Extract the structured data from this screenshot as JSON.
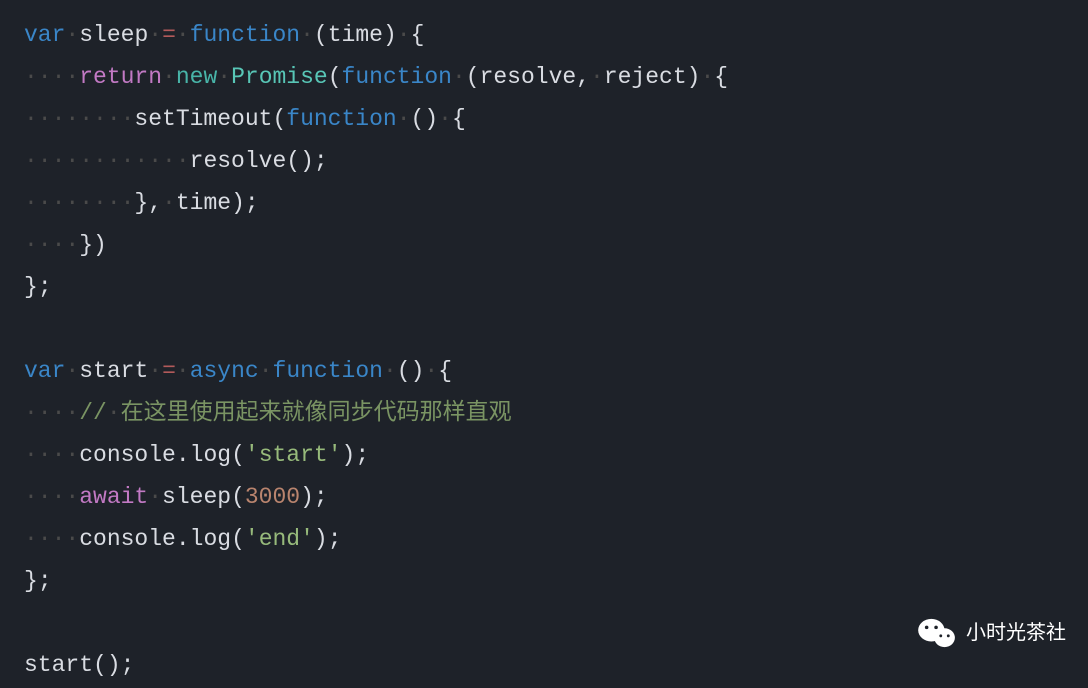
{
  "code": {
    "line1": {
      "var": "var",
      "ws1": "·",
      "name": "sleep",
      "ws2": "·",
      "eq": "=",
      "ws3": "·",
      "func": "function",
      "ws4": "·",
      "lparen": "(",
      "param": "time",
      "rparen": ")",
      "ws5": "·",
      "lbrace": "{"
    },
    "line2": {
      "ws_lead": "····",
      "ret": "return",
      "ws1": "·",
      "new": "new",
      "ws2": "·",
      "cls": "Promise",
      "lparen": "(",
      "func": "function",
      "ws3": "·",
      "lparen2": "(",
      "p1": "resolve",
      "comma": ",",
      "ws4": "·",
      "p2": "reject",
      "rparen2": ")",
      "ws5": "·",
      "lbrace": "{"
    },
    "line3": {
      "ws_lead": "········",
      "fn": "setTimeout",
      "lparen": "(",
      "func": "function",
      "ws1": "·",
      "lparen2": "(",
      "rparen2": ")",
      "ws2": "·",
      "lbrace": "{"
    },
    "line4": {
      "ws_lead": "············",
      "fn": "resolve",
      "lparen": "(",
      "rparen": ")",
      "semi": ";"
    },
    "line5": {
      "ws_lead": "········",
      "rbrace": "}",
      "comma": ",",
      "ws1": "·",
      "arg": "time",
      "rparen": ")",
      "semi": ";"
    },
    "line6": {
      "ws_lead": "····",
      "rbrace": "}",
      "rparen": ")"
    },
    "line7": {
      "rbrace": "}",
      "semi": ";"
    },
    "line9": {
      "var": "var",
      "ws1": "·",
      "name": "start",
      "ws2": "·",
      "eq": "=",
      "ws3": "·",
      "async": "async",
      "ws4": "·",
      "func": "function",
      "ws5": "·",
      "lparen": "(",
      "rparen": ")",
      "ws6": "·",
      "lbrace": "{"
    },
    "line10": {
      "ws_lead": "····",
      "slashes": "//",
      "ws1": "·",
      "text": "在这里使用起来就像同步代码那样直观"
    },
    "line11": {
      "ws_lead": "····",
      "obj": "console",
      "dot": ".",
      "method": "log",
      "lparen": "(",
      "str": "'start'",
      "rparen": ")",
      "semi": ";"
    },
    "line12": {
      "ws_lead": "····",
      "await": "await",
      "ws1": "·",
      "fn": "sleep",
      "lparen": "(",
      "num": "3000",
      "rparen": ")",
      "semi": ";"
    },
    "line13": {
      "ws_lead": "····",
      "obj": "console",
      "dot": ".",
      "method": "log",
      "lparen": "(",
      "str": "'end'",
      "rparen": ")",
      "semi": ";"
    },
    "line14": {
      "rbrace": "}",
      "semi": ";"
    },
    "line16": {
      "fn": "start",
      "lparen": "(",
      "rparen": ")",
      "semi": ";"
    }
  },
  "watermark": {
    "text": "小时光茶社"
  }
}
